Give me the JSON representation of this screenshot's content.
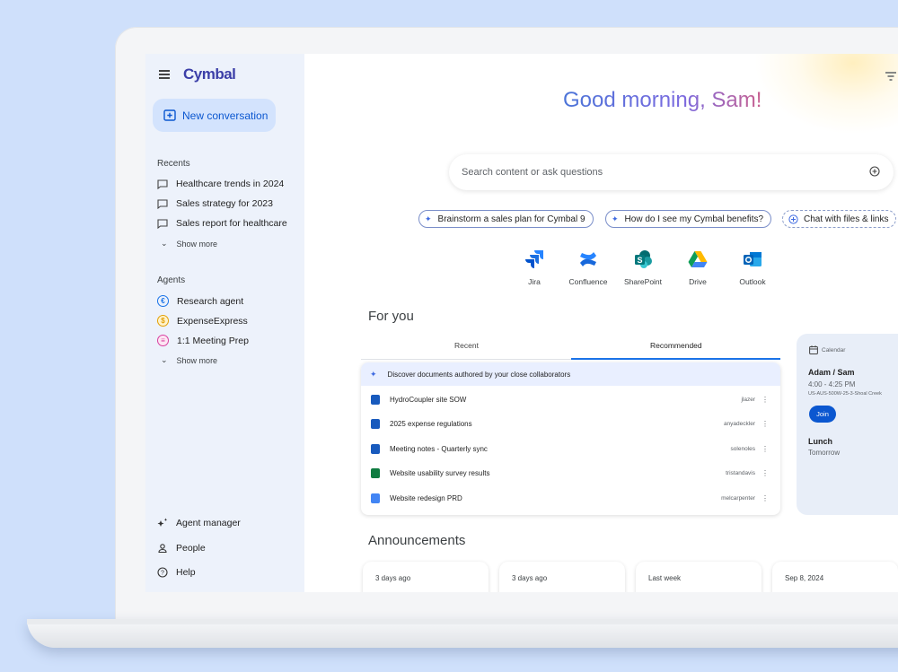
{
  "app": {
    "logo": "Cymbal",
    "new_conversation": "New conversation"
  },
  "sidebar": {
    "recents_title": "Recents",
    "recents": [
      {
        "label": "Healthcare trends in 2024"
      },
      {
        "label": "Sales strategy for 2023"
      },
      {
        "label": "Sales report for healthcare"
      }
    ],
    "recents_show_more": "Show more",
    "agents_title": "Agents",
    "agents": [
      {
        "label": "Research agent",
        "color": "#1a73e8"
      },
      {
        "label": "ExpenseExpress",
        "color": "#e3a008"
      },
      {
        "label": "1:1 Meeting Prep",
        "color": "#d93fa0"
      }
    ],
    "agents_show_more": "Show more",
    "bottom": [
      {
        "label": "Agent manager"
      },
      {
        "label": "People"
      },
      {
        "label": "Help"
      }
    ]
  },
  "main": {
    "greeting": "Good morning, Sam!",
    "search_placeholder": "Search content or ask questions",
    "chips": [
      {
        "label": "Brainstorm a sales plan for Cymbal 9"
      },
      {
        "label": "How do I see my Cymbal benefits?"
      },
      {
        "label": "Chat with files & links"
      }
    ],
    "apps": [
      {
        "label": "Jira",
        "icon": "jira-icon"
      },
      {
        "label": "Confluence",
        "icon": "confluence-icon"
      },
      {
        "label": "SharePoint",
        "icon": "sharepoint-icon"
      },
      {
        "label": "Drive",
        "icon": "drive-icon"
      },
      {
        "label": "Outlook",
        "icon": "outlook-icon"
      }
    ],
    "for_you_title": "For you",
    "tabs": [
      {
        "label": "Recent"
      },
      {
        "label": "Recommended"
      }
    ],
    "feed_header": "Discover documents authored by your close collaborators",
    "docs": [
      {
        "title": "HydroCoupler site SOW",
        "owner": "jlazer",
        "type": "word",
        "color": "#185abd"
      },
      {
        "title": "2025 expense regulations",
        "owner": "anyadeckler",
        "type": "word",
        "color": "#185abd"
      },
      {
        "title": "Meeting notes - Quarterly sync",
        "owner": "solenoles",
        "type": "word",
        "color": "#185abd"
      },
      {
        "title": "Website usability survey results",
        "owner": "tristandavis",
        "type": "excel",
        "color": "#107c41"
      },
      {
        "title": "Website redesign PRD",
        "owner": "melcarpenter",
        "type": "docs",
        "color": "#4285f4"
      }
    ],
    "calendar": {
      "label": "Calendar",
      "event1_title": "Adam / Sam",
      "event1_time": "4:00 - 4:25 PM",
      "event1_room": "US-AUS-500W-25-3-Shoal Creek",
      "join_label": "Join",
      "event2_title": "Lunch",
      "event2_time": "Tomorrow"
    },
    "announcements_title": "Announcements",
    "announcements": [
      {
        "date": "3 days ago"
      },
      {
        "date": "3 days ago"
      },
      {
        "date": "Last week"
      },
      {
        "date": "Sep 8, 2024"
      }
    ]
  }
}
